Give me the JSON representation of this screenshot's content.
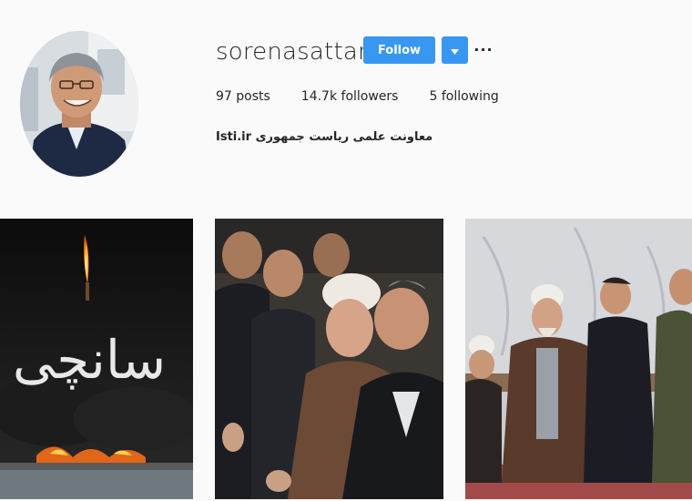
{
  "profile": {
    "username": "sorenasattari",
    "follow_label": "Follow",
    "dropdown_icon": "caret-down-icon",
    "more_icon": "more-options-icon",
    "more_glyph": "···",
    "stats": {
      "posts": "97 posts",
      "followers": "14.7k followers",
      "following": "5 following"
    },
    "bio": "Isti.ir معاونت علمی ریاست جمهوری"
  },
  "posts": [
    {
      "name": "post-sanchi-candle",
      "caption_art": "سانچی"
    },
    {
      "name": "post-ceremony-audience"
    },
    {
      "name": "post-clerics-group"
    }
  ],
  "colors": {
    "accent": "#3897f0",
    "background": "#fafafa",
    "text": "#262626"
  }
}
